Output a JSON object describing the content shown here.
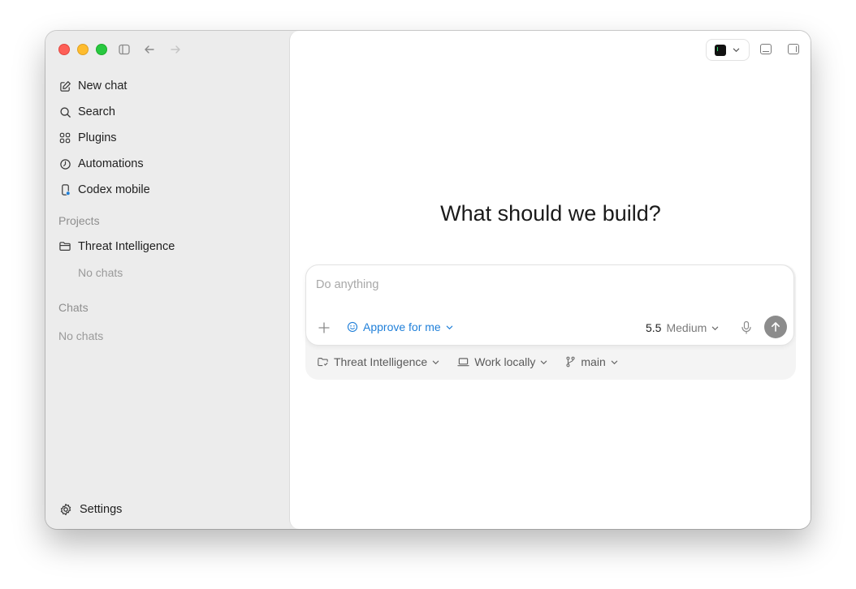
{
  "sidebar": {
    "nav_items": [
      {
        "label": "New chat",
        "icon": "new-chat-icon"
      },
      {
        "label": "Search",
        "icon": "search-icon"
      },
      {
        "label": "Plugins",
        "icon": "plugins-icon"
      },
      {
        "label": "Automations",
        "icon": "automations-icon"
      },
      {
        "label": "Codex mobile",
        "icon": "mobile-icon"
      }
    ],
    "projects_label": "Projects",
    "project": {
      "label": "Threat Intelligence",
      "icon": "folder-icon"
    },
    "project_empty": "No chats",
    "chats_label": "Chats",
    "chats_empty": "No chats",
    "settings_label": "Settings"
  },
  "main": {
    "heading": "What should we build?",
    "composer": {
      "placeholder": "Do anything",
      "approve_label": "Approve for me",
      "model_version": "5.5",
      "model_level": "Medium"
    },
    "context": {
      "project": "Threat Intelligence",
      "environment": "Work locally",
      "branch": "main"
    }
  },
  "colors": {
    "accent": "#1f7fd9",
    "sidebar_bg": "#ececec",
    "send_button": "#8c8c8c"
  }
}
